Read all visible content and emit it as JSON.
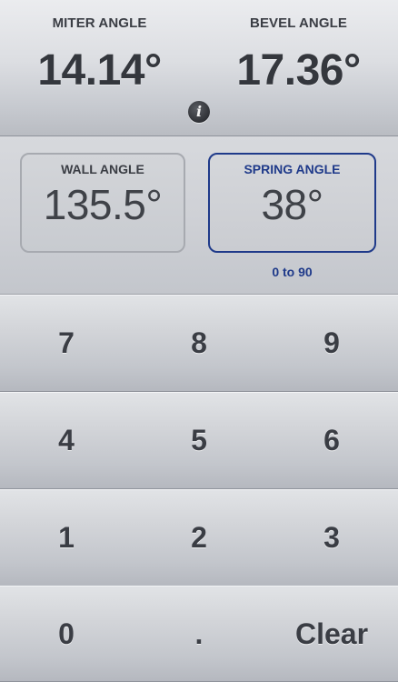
{
  "results": {
    "miter": {
      "label": "MITER ANGLE",
      "value": "14.14°"
    },
    "bevel": {
      "label": "BEVEL ANGLE",
      "value": "17.36°"
    },
    "info_icon": {
      "glyph": "i",
      "icon": "info-icon"
    }
  },
  "inputs": {
    "wall": {
      "label": "WALL ANGLE",
      "value": "135.5°"
    },
    "spring": {
      "label": "SPRING ANGLE",
      "value": "38°",
      "range": "0 to 90"
    },
    "active_field": "spring",
    "active_color": "#1f3a8a"
  },
  "keypad": {
    "rows": [
      [
        "7",
        "8",
        "9"
      ],
      [
        "4",
        "5",
        "6"
      ],
      [
        "1",
        "2",
        "3"
      ],
      [
        "0",
        ".",
        "Clear"
      ]
    ]
  }
}
